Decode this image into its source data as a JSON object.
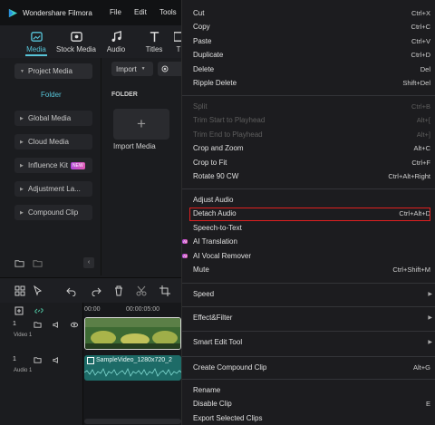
{
  "app": {
    "name": "Wondershare Filmora",
    "menu": [
      "File",
      "Edit",
      "Tools",
      "T"
    ]
  },
  "toolbar": {
    "items": [
      {
        "label": "Media",
        "icon": "media-icon",
        "active": true
      },
      {
        "label": "Stock Media",
        "icon": "stock-media-icon",
        "active": false
      },
      {
        "label": "Audio",
        "icon": "music-note-icon",
        "active": false
      },
      {
        "label": "Titles",
        "icon": "titles-icon",
        "active": false
      },
      {
        "label": "T",
        "icon": "transitions-icon",
        "active": false
      }
    ]
  },
  "sidebar": {
    "items": [
      {
        "label": "Project Media",
        "open": true
      },
      {
        "label": "Global Media"
      },
      {
        "label": "Cloud Media"
      },
      {
        "label": "Influence Kit",
        "badge": "NEW"
      },
      {
        "label": "Adjustment La..."
      },
      {
        "label": "Compound Clip"
      }
    ],
    "folder": "Folder"
  },
  "media": {
    "import_label": "Import",
    "folder_heading": "FOLDER",
    "import_tile_plus": "+",
    "import_tile_label": "Import Media"
  },
  "timeline": {
    "ruler": [
      "00:00",
      "00:00:05:00"
    ],
    "video_track": {
      "number": "1",
      "label": "Video 1"
    },
    "audio_track": {
      "number": "1",
      "label": "Audio 1"
    },
    "audio_clip_name": "SampleVideo_1280x720_2"
  },
  "context_menu": {
    "groups": [
      [
        {
          "label": "Cut",
          "shortcut": "Ctrl+X"
        },
        {
          "label": "Copy",
          "shortcut": "Ctrl+C"
        },
        {
          "label": "Paste",
          "shortcut": "Ctrl+V"
        },
        {
          "label": "Duplicate",
          "shortcut": "Ctrl+D"
        },
        {
          "label": "Delete",
          "shortcut": "Del"
        },
        {
          "label": "Ripple Delete",
          "shortcut": "Shift+Del"
        }
      ],
      [
        {
          "label": "Split",
          "shortcut": "Ctrl+B",
          "disabled": true
        },
        {
          "label": "Trim Start to Playhead",
          "shortcut": "Alt+[",
          "disabled": true
        },
        {
          "label": "Trim End to Playhead",
          "shortcut": "Alt+]",
          "disabled": true
        },
        {
          "label": "Crop and Zoom",
          "shortcut": "Alt+C"
        },
        {
          "label": "Crop to Fit",
          "shortcut": "Ctrl+F"
        },
        {
          "label": "Rotate 90 CW",
          "shortcut": "Ctrl+Alt+Right"
        }
      ],
      [
        {
          "label": "Adjust Audio",
          "shortcut": ""
        },
        {
          "label": "Detach Audio",
          "shortcut": "Ctrl+Alt+D",
          "highlighted": true
        },
        {
          "label": "Speech-to-Text",
          "shortcut": ""
        },
        {
          "label": "AI Translation",
          "shortcut": "",
          "ai": true
        },
        {
          "label": "AI Vocal Remover",
          "shortcut": "",
          "ai": true
        },
        {
          "label": "Mute",
          "shortcut": "Ctrl+Shift+M"
        }
      ],
      [
        {
          "label": "Speed",
          "submenu": true
        }
      ],
      [
        {
          "label": "Effect&Filter",
          "submenu": true
        }
      ],
      [
        {
          "label": "Smart Edit Tool",
          "submenu": true
        }
      ],
      [
        {
          "label": "Create Compound Clip",
          "shortcut": "Alt+G"
        }
      ],
      [
        {
          "label": "Rename",
          "shortcut": ""
        },
        {
          "label": "Disable Clip",
          "shortcut": "E"
        },
        {
          "label": "Export Selected Clips",
          "shortcut": ""
        }
      ]
    ],
    "ai_badge": "AI",
    "submenu_arrow": "▶"
  },
  "colors": {
    "accent": "#57c4d8",
    "highlight_border": "#e02020",
    "menu_bg": "#1c1c1f",
    "app_bg": "#1b1c1f"
  }
}
